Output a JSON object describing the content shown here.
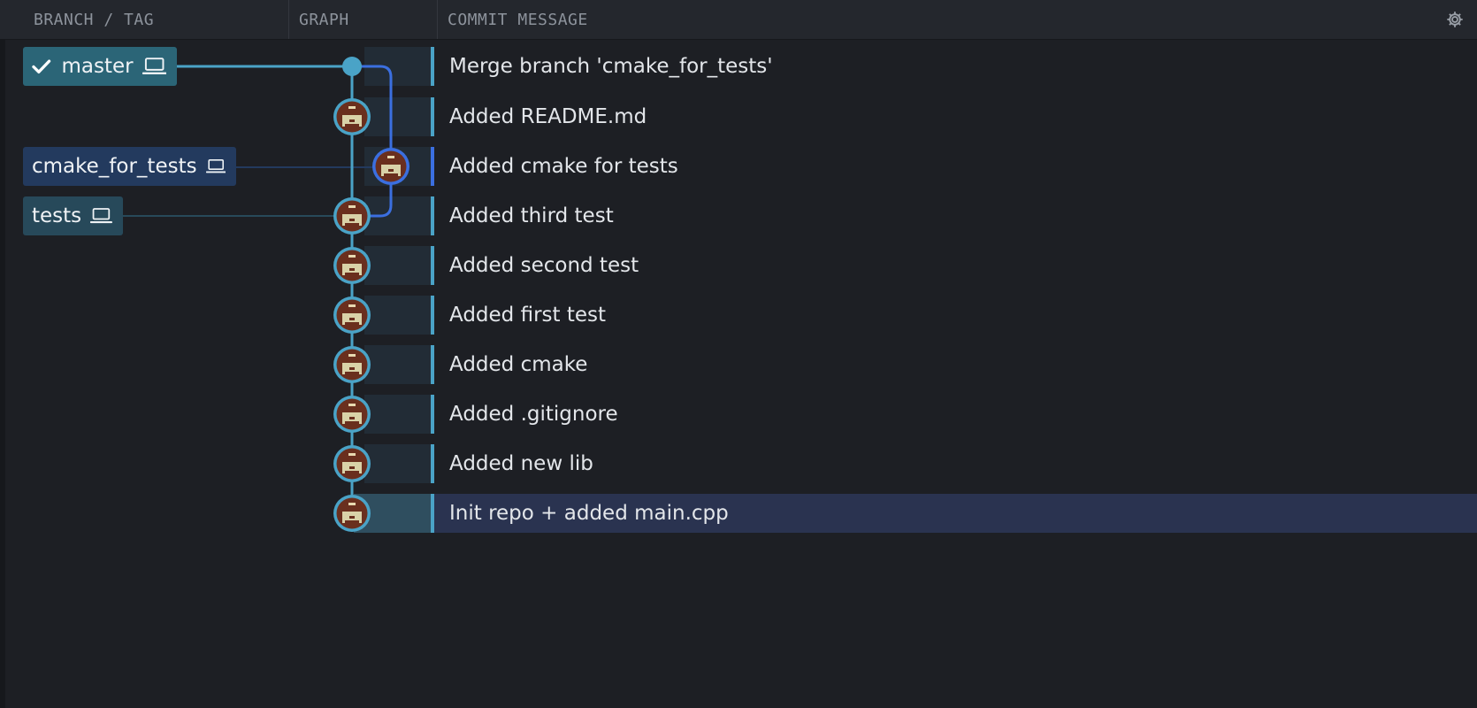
{
  "header": {
    "branch_tag": "BRANCH / TAG",
    "graph": "GRAPH",
    "commit_message": "COMMIT MESSAGE",
    "settings_icon": "gear-icon"
  },
  "branches": [
    {
      "name": "master",
      "checked_out": true,
      "icon": "laptop-icon",
      "color": "#2b6577"
    },
    {
      "name": "cmake_for_tests",
      "checked_out": false,
      "icon": "laptop-icon",
      "color": "#233a5e"
    },
    {
      "name": "tests",
      "checked_out": false,
      "icon": "laptop-icon",
      "color": "#27495a"
    }
  ],
  "commits": [
    {
      "message": "Merge branch 'cmake_for_tests'",
      "avatar": false
    },
    {
      "message": "Added README.md",
      "avatar": true
    },
    {
      "message": "Added cmake for tests",
      "avatar": true
    },
    {
      "message": "Added third test",
      "avatar": true
    },
    {
      "message": "Added second test",
      "avatar": true
    },
    {
      "message": "Added first test",
      "avatar": true
    },
    {
      "message": "Added cmake",
      "avatar": true
    },
    {
      "message": "Added .gitignore",
      "avatar": true
    },
    {
      "message": "Added new lib",
      "avatar": true
    },
    {
      "message": "Init repo + added main.cpp",
      "avatar": true,
      "selected": true
    }
  ],
  "colors": {
    "accent_teal": "#4aa3c7",
    "accent_blue": "#3b6fe0",
    "selection": "#2a3350"
  }
}
